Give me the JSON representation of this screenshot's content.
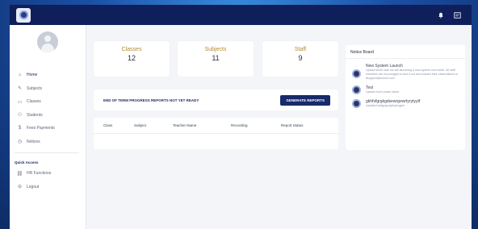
{
  "topbar": {
    "logo_icon": "school-logo-icon",
    "notification_icon": "bell-icon",
    "messages_icon": "message-icon"
  },
  "sidebar": {
    "items": [
      {
        "label": "Home",
        "icon": "home-icon"
      },
      {
        "label": "Subjects",
        "icon": "edit-icon"
      },
      {
        "label": "Classes",
        "icon": "book-icon"
      },
      {
        "label": "Students",
        "icon": "people-icon"
      },
      {
        "label": "Fees Payments",
        "icon": "dollar-icon"
      },
      {
        "label": "Notices",
        "icon": "notice-icon"
      }
    ],
    "quick_access_title": "Quick Access",
    "quick_items": [
      {
        "label": "HR Functions",
        "icon": "link-icon"
      },
      {
        "label": "Logout",
        "icon": "lock-icon"
      }
    ]
  },
  "stats": [
    {
      "label": "Classes",
      "value": "12"
    },
    {
      "label": "Subjects",
      "value": "11"
    },
    {
      "label": "Staff",
      "value": "9"
    }
  ],
  "alert": {
    "text": "END OF TERM PROGRESS REPORTS NOT YET READY",
    "button_label": "GENERATE REPORTS"
  },
  "table": {
    "headers": [
      "Class",
      "Subject",
      "Teacher Name",
      "Recording",
      "Report Status"
    ]
  },
  "notice_board": {
    "title": "Notice Board",
    "items": [
      {
        "title": "New System Launch",
        "body": "Upload these note we will launching a new system next week. All staff members are encouraged to test it out and forward their observations to itsupport@school.com"
      },
      {
        "title": "Test",
        "body": "Upload more power stone"
      },
      {
        "title": "gkhfsfgrgkgdsewrgewrtyrytyytf",
        "body": "Updated wefgegvytytvyhryghe"
      }
    ]
  },
  "colors": {
    "topbar": "#0f1f5c",
    "accent_gold": "#b58a2b",
    "button": "#172a6b"
  }
}
